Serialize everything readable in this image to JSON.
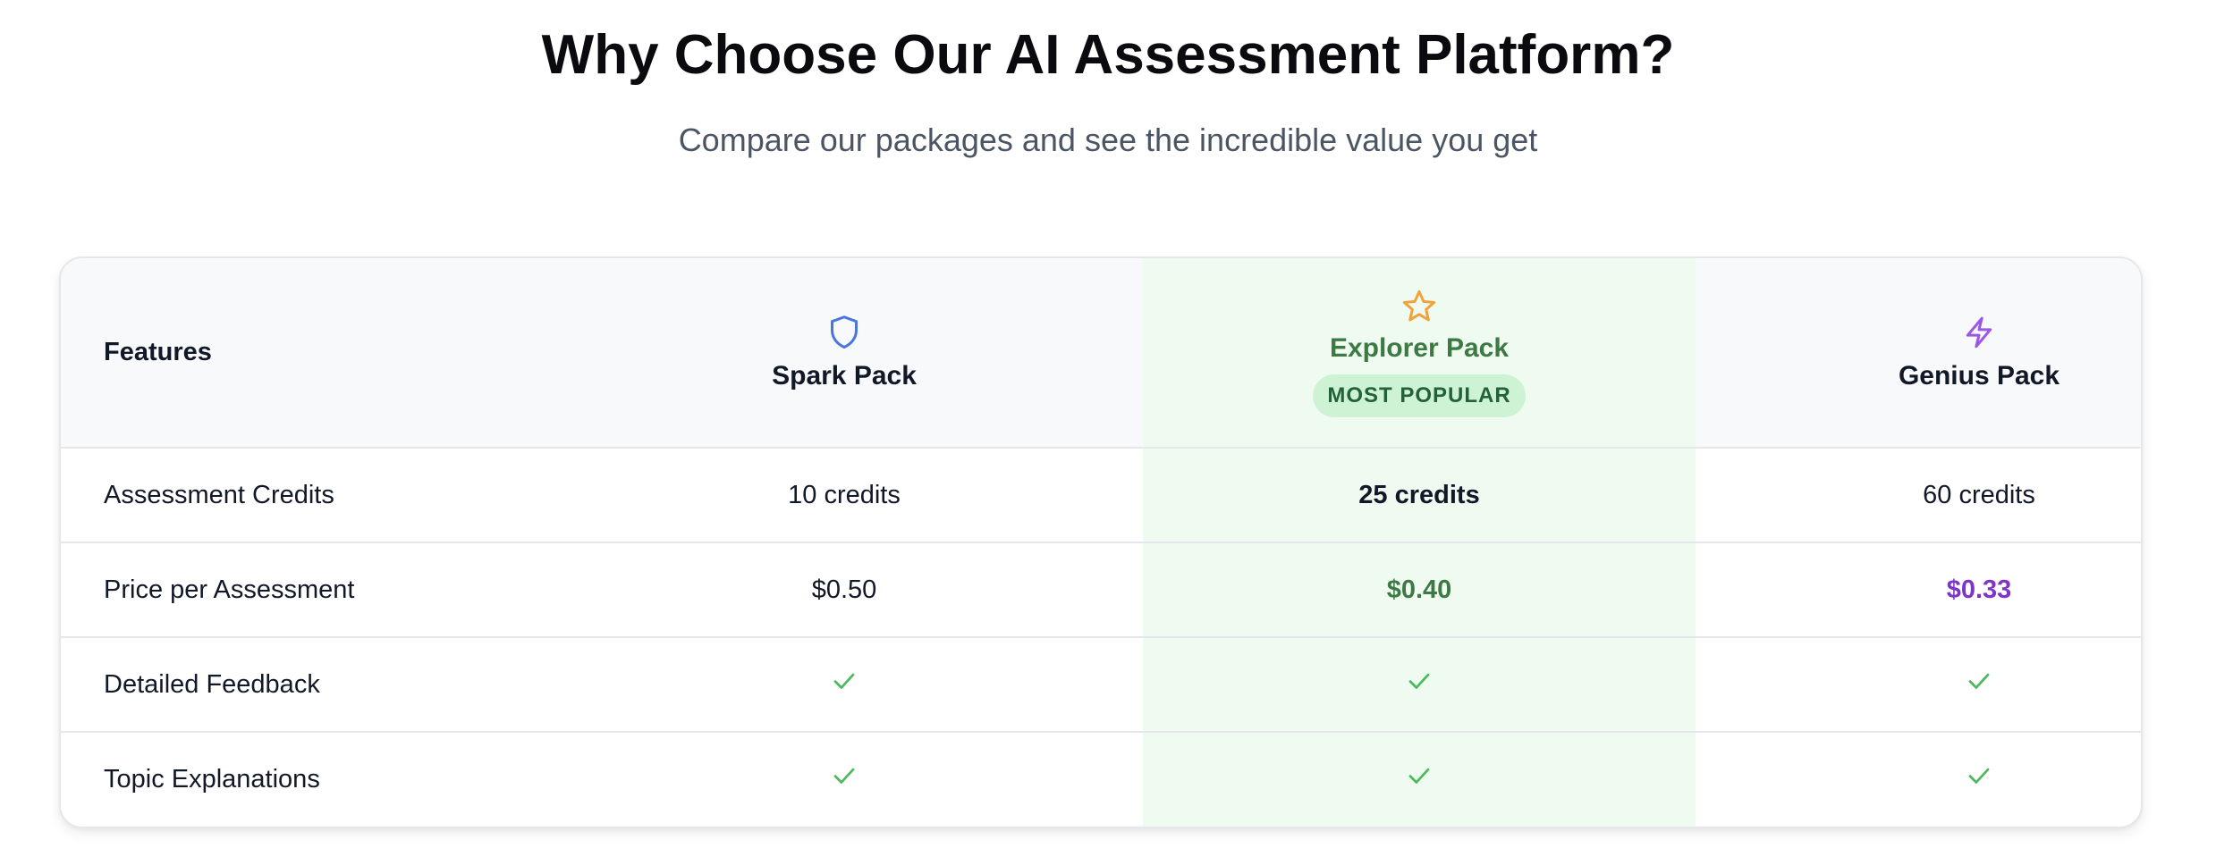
{
  "header": {
    "title": "Why Choose Our AI Assessment Platform?",
    "subtitle": "Compare our packages and see the incredible value you get"
  },
  "colors": {
    "spark_icon": "#4a76e0",
    "explorer_icon": "#f0a23b",
    "genius_icon": "#9b58e8",
    "check": "#4cba5c",
    "explorer_accent": "#3d7a43",
    "genius_accent": "#7e34c9",
    "highlight_bg": "#effbf1"
  },
  "table": {
    "features_header": "Features",
    "packs": [
      {
        "name": "Spark Pack",
        "icon": "shield-icon"
      },
      {
        "name": "Explorer Pack",
        "icon": "star-icon",
        "badge": "MOST POPULAR"
      },
      {
        "name": "Genius Pack",
        "icon": "lightning-icon"
      }
    ],
    "rows": [
      {
        "label": "Assessment Credits",
        "values": [
          "10 credits",
          "25 credits",
          "60 credits"
        ]
      },
      {
        "label": "Price per Assessment",
        "values": [
          "$0.50",
          "$0.40",
          "$0.33"
        ]
      },
      {
        "label": "Detailed Feedback",
        "values": [
          "check",
          "check",
          "check"
        ]
      },
      {
        "label": "Topic Explanations",
        "values": [
          "check",
          "check",
          "check"
        ]
      }
    ]
  }
}
